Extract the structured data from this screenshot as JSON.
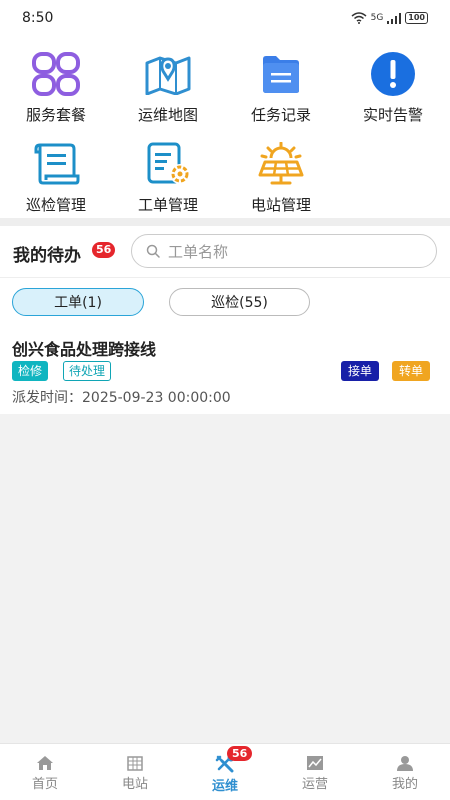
{
  "status_bar": {
    "time": "8:50",
    "signal": "5G",
    "battery": "100"
  },
  "grid": [
    {
      "label": "服务套餐",
      "icon": "package-icon"
    },
    {
      "label": "运维地图",
      "icon": "map-icon"
    },
    {
      "label": "任务记录",
      "icon": "folder-icon"
    },
    {
      "label": "实时告警",
      "icon": "alert-icon"
    },
    {
      "label": "巡检管理",
      "icon": "inspection-icon"
    },
    {
      "label": "工单管理",
      "icon": "work-order-icon"
    },
    {
      "label": "电站管理",
      "icon": "solar-station-icon"
    }
  ],
  "todo": {
    "title": "我的待办",
    "count": "56",
    "search_placeholder": "工单名称",
    "tabs": [
      {
        "label": "工单(1)",
        "active": true
      },
      {
        "label": "巡检(55)",
        "active": false
      }
    ],
    "item": {
      "title": "创兴食品处理跨接线",
      "tags": [
        "检修",
        "待处理"
      ],
      "actions": [
        "接单",
        "转单"
      ],
      "dispatch_label": "派发时间：",
      "dispatch_time": "2025-09-23 00:00:00"
    }
  },
  "nav": {
    "items": [
      {
        "label": "首页",
        "icon": "home-icon"
      },
      {
        "label": "电站",
        "icon": "station-icon"
      },
      {
        "label": "运维",
        "icon": "tools-icon",
        "active": true,
        "badge": "56"
      },
      {
        "label": "运营",
        "icon": "chart-icon"
      },
      {
        "label": "我的",
        "icon": "user-icon"
      }
    ]
  },
  "colors": {
    "accent": "#2f8fd0",
    "badge": "#e5262c",
    "teal": "#10b5c0",
    "navy": "#1820a8",
    "orange": "#f0a520"
  }
}
